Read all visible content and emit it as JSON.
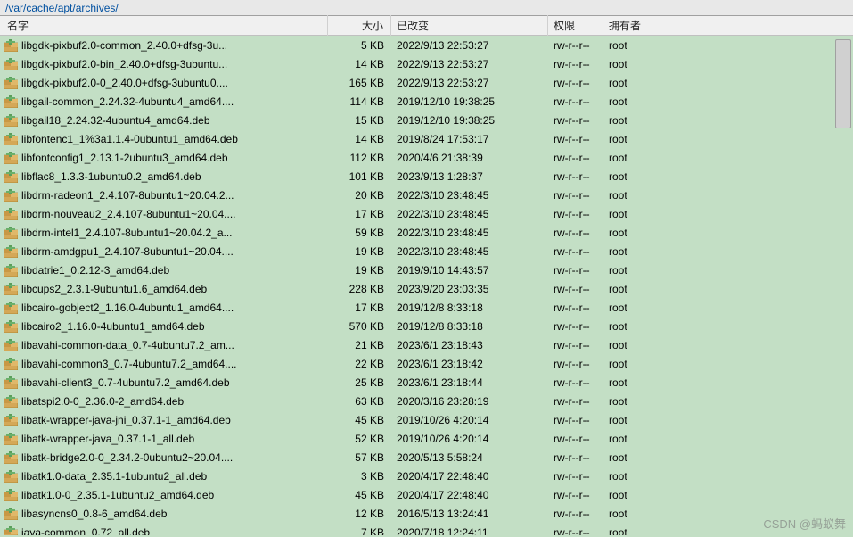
{
  "path": "/var/cache/apt/archives/",
  "columns": {
    "name": "名字",
    "size": "大小",
    "changed": "已改变",
    "perm": "权限",
    "owner": "拥有者"
  },
  "watermark": "CSDN @蚂蚁舞",
  "files": [
    {
      "name": "libgdk-pixbuf2.0-common_2.40.0+dfsg-3u...",
      "size": "5 KB",
      "changed": "2022/9/13 22:53:27",
      "perm": "rw-r--r--",
      "owner": "root"
    },
    {
      "name": "libgdk-pixbuf2.0-bin_2.40.0+dfsg-3ubuntu...",
      "size": "14 KB",
      "changed": "2022/9/13 22:53:27",
      "perm": "rw-r--r--",
      "owner": "root"
    },
    {
      "name": "libgdk-pixbuf2.0-0_2.40.0+dfsg-3ubuntu0....",
      "size": "165 KB",
      "changed": "2022/9/13 22:53:27",
      "perm": "rw-r--r--",
      "owner": "root"
    },
    {
      "name": "libgail-common_2.24.32-4ubuntu4_amd64....",
      "size": "114 KB",
      "changed": "2019/12/10 19:38:25",
      "perm": "rw-r--r--",
      "owner": "root"
    },
    {
      "name": "libgail18_2.24.32-4ubuntu4_amd64.deb",
      "size": "15 KB",
      "changed": "2019/12/10 19:38:25",
      "perm": "rw-r--r--",
      "owner": "root"
    },
    {
      "name": "libfontenc1_1%3a1.1.4-0ubuntu1_amd64.deb",
      "size": "14 KB",
      "changed": "2019/8/24 17:53:17",
      "perm": "rw-r--r--",
      "owner": "root"
    },
    {
      "name": "libfontconfig1_2.13.1-2ubuntu3_amd64.deb",
      "size": "112 KB",
      "changed": "2020/4/6 21:38:39",
      "perm": "rw-r--r--",
      "owner": "root"
    },
    {
      "name": "libflac8_1.3.3-1ubuntu0.2_amd64.deb",
      "size": "101 KB",
      "changed": "2023/9/13 1:28:37",
      "perm": "rw-r--r--",
      "owner": "root"
    },
    {
      "name": "libdrm-radeon1_2.4.107-8ubuntu1~20.04.2...",
      "size": "20 KB",
      "changed": "2022/3/10 23:48:45",
      "perm": "rw-r--r--",
      "owner": "root"
    },
    {
      "name": "libdrm-nouveau2_2.4.107-8ubuntu1~20.04....",
      "size": "17 KB",
      "changed": "2022/3/10 23:48:45",
      "perm": "rw-r--r--",
      "owner": "root"
    },
    {
      "name": "libdrm-intel1_2.4.107-8ubuntu1~20.04.2_a...",
      "size": "59 KB",
      "changed": "2022/3/10 23:48:45",
      "perm": "rw-r--r--",
      "owner": "root"
    },
    {
      "name": "libdrm-amdgpu1_2.4.107-8ubuntu1~20.04....",
      "size": "19 KB",
      "changed": "2022/3/10 23:48:45",
      "perm": "rw-r--r--",
      "owner": "root"
    },
    {
      "name": "libdatrie1_0.2.12-3_amd64.deb",
      "size": "19 KB",
      "changed": "2019/9/10 14:43:57",
      "perm": "rw-r--r--",
      "owner": "root"
    },
    {
      "name": "libcups2_2.3.1-9ubuntu1.6_amd64.deb",
      "size": "228 KB",
      "changed": "2023/9/20 23:03:35",
      "perm": "rw-r--r--",
      "owner": "root"
    },
    {
      "name": "libcairo-gobject2_1.16.0-4ubuntu1_amd64....",
      "size": "17 KB",
      "changed": "2019/12/8 8:33:18",
      "perm": "rw-r--r--",
      "owner": "root"
    },
    {
      "name": "libcairo2_1.16.0-4ubuntu1_amd64.deb",
      "size": "570 KB",
      "changed": "2019/12/8 8:33:18",
      "perm": "rw-r--r--",
      "owner": "root"
    },
    {
      "name": "libavahi-common-data_0.7-4ubuntu7.2_am...",
      "size": "21 KB",
      "changed": "2023/6/1 23:18:43",
      "perm": "rw-r--r--",
      "owner": "root"
    },
    {
      "name": "libavahi-common3_0.7-4ubuntu7.2_amd64....",
      "size": "22 KB",
      "changed": "2023/6/1 23:18:42",
      "perm": "rw-r--r--",
      "owner": "root"
    },
    {
      "name": "libavahi-client3_0.7-4ubuntu7.2_amd64.deb",
      "size": "25 KB",
      "changed": "2023/6/1 23:18:44",
      "perm": "rw-r--r--",
      "owner": "root"
    },
    {
      "name": "libatspi2.0-0_2.36.0-2_amd64.deb",
      "size": "63 KB",
      "changed": "2020/3/16 23:28:19",
      "perm": "rw-r--r--",
      "owner": "root"
    },
    {
      "name": "libatk-wrapper-java-jni_0.37.1-1_amd64.deb",
      "size": "45 KB",
      "changed": "2019/10/26 4:20:14",
      "perm": "rw-r--r--",
      "owner": "root"
    },
    {
      "name": "libatk-wrapper-java_0.37.1-1_all.deb",
      "size": "52 KB",
      "changed": "2019/10/26 4:20:14",
      "perm": "rw-r--r--",
      "owner": "root"
    },
    {
      "name": "libatk-bridge2.0-0_2.34.2-0ubuntu2~20.04....",
      "size": "57 KB",
      "changed": "2020/5/13 5:58:24",
      "perm": "rw-r--r--",
      "owner": "root"
    },
    {
      "name": "libatk1.0-data_2.35.1-1ubuntu2_all.deb",
      "size": "3 KB",
      "changed": "2020/4/17 22:48:40",
      "perm": "rw-r--r--",
      "owner": "root"
    },
    {
      "name": "libatk1.0-0_2.35.1-1ubuntu2_amd64.deb",
      "size": "45 KB",
      "changed": "2020/4/17 22:48:40",
      "perm": "rw-r--r--",
      "owner": "root"
    },
    {
      "name": "libasyncns0_0.8-6_amd64.deb",
      "size": "12 KB",
      "changed": "2016/5/13 13:24:41",
      "perm": "rw-r--r--",
      "owner": "root"
    },
    {
      "name": "java-common_0.72_all.deb",
      "size": "7 KB",
      "changed": "2020/7/18 12:24:11",
      "perm": "rw-r--r--",
      "owner": "root"
    }
  ]
}
